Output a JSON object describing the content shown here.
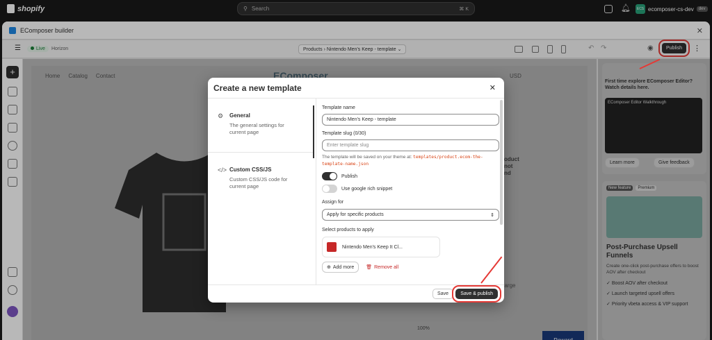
{
  "shopify": {
    "brand": "shopify",
    "search_placeholder": "Search",
    "shortcut": "⌘ K",
    "store_initials": "ECS",
    "store_name": "ecomposer-cs-dev",
    "store_badge": "dev"
  },
  "app": {
    "title": "EComposer builder"
  },
  "editor": {
    "live_label": "Live",
    "theme_name": "Horizon",
    "breadcrumb_products": "Products",
    "breadcrumb_template": "Nintendo Men's Keep - template",
    "publish_label": "Publish"
  },
  "store_page": {
    "nav": [
      "Home",
      "Catalog",
      "Contact"
    ],
    "brand": "EComposer",
    "currency": "USD",
    "zoom": "100%",
    "reward_label": "Reward",
    "side_text": [
      "oduct",
      "not",
      "nd"
    ],
    "size_label": "Large"
  },
  "right_panel": {
    "promo_title": "First time explore EComposer Editor? Watch details here.",
    "video_title": "EComposer Editor Walkthrough",
    "learn_more": "Learn more",
    "give_feedback": "Give feedback",
    "tag_new": "New feature",
    "tag_premium": "Premium",
    "upsell_title": "Post-Purchase Upsell Funnels",
    "upsell_desc": "Create one-click post-purchase offers to boost AOV after checkout",
    "bullets": [
      "Boost AOV after checkout",
      "Launch targeted upsell offers",
      "Priority vbeta access & VIP support"
    ]
  },
  "modal": {
    "title": "Create a new template",
    "nav": [
      {
        "title": "General",
        "desc": "The general settings for current page"
      },
      {
        "title": "Custom CSS/JS",
        "desc": "Custom CSS/JS code for current page"
      }
    ],
    "template_name_label": "Template name",
    "template_name_value": "Nintendo Men's Keep - template",
    "slug_label": "Template slug (0/30)",
    "slug_placeholder": "Enter template slug",
    "hint_prefix": "The template will be saved on your theme at:",
    "hint_path": "templates/product.ecom-the-template-name.json",
    "publish_toggle_label": "Publish",
    "rich_snippet_label": "Use google rich snippet",
    "assign_label": "Assign for",
    "assign_value": "Apply for specific products",
    "select_products_label": "Select products to apply",
    "product_name": "Nintendo Men's Keep It Cl...",
    "add_more": "Add more",
    "remove_all": "Remove all",
    "save": "Save",
    "save_publish": "Save & publish"
  }
}
